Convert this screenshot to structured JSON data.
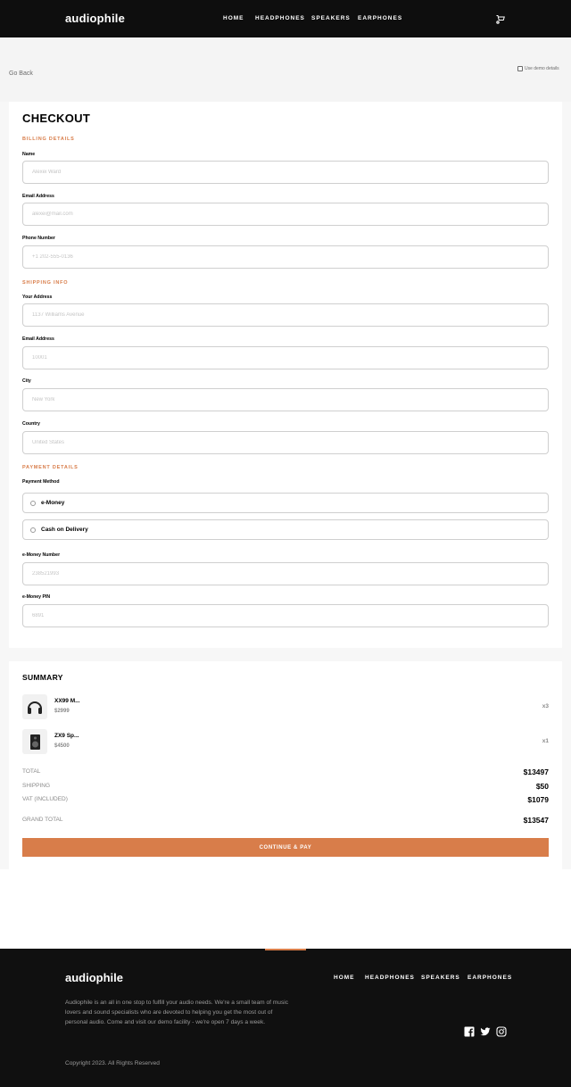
{
  "header": {
    "logo": "audiophile",
    "nav": [
      "HOME",
      "HEADPHONES",
      "SPEAKERS",
      "EARPHONES"
    ],
    "cart_icon": "cart-icon"
  },
  "subbar": {
    "go_back": "Go Back",
    "demo_label": "Use demo details"
  },
  "checkout": {
    "title": "CHECKOUT",
    "billing": {
      "heading": "BILLING DETAILS",
      "name_label": "Name",
      "name_placeholder": "Alexei Ward",
      "email_label": "Email Address",
      "email_placeholder": "alexei@mail.com",
      "phone_label": "Phone Number",
      "phone_placeholder": "+1 202-555-0136"
    },
    "shipping": {
      "heading": "SHIPPING INFO",
      "address_label": "Your Address",
      "address_placeholder": "1137 Williams Avenue",
      "zip_label": "Email Address",
      "zip_placeholder": "10001",
      "city_label": "City",
      "city_placeholder": "New York",
      "country_label": "Country",
      "country_placeholder": "United States"
    },
    "payment": {
      "heading": "PAYMENT DETAILS",
      "method_label": "Payment Method",
      "options": [
        "e-Money",
        "Cash on Delivery"
      ],
      "emoney_number_label": "e-Money Number",
      "emoney_number_placeholder": "238521993",
      "emoney_pin_label": "e-Money PIN",
      "emoney_pin_placeholder": "6891"
    }
  },
  "summary": {
    "title": "SUMMARY",
    "items": [
      {
        "name": "XX99 M...",
        "price": "$2999",
        "qty": "x3",
        "icon": "headphones-icon"
      },
      {
        "name": "ZX9 Sp...",
        "price": "$4500",
        "qty": "x1",
        "icon": "speaker-icon"
      }
    ],
    "totals": {
      "total_label": "TOTAL",
      "total_value": "$13497",
      "shipping_label": "SHIPPING",
      "shipping_value": "$50",
      "vat_label": "VAT (INCLUDED)",
      "vat_value": "$1079",
      "grand_label": "GRAND TOTAL",
      "grand_value": "$13547"
    },
    "pay_button": "CONTINUE & PAY"
  },
  "footer": {
    "logo": "audiophile",
    "nav": [
      "HOME",
      "HEADPHONES",
      "SPEAKERS",
      "EARPHONES"
    ],
    "about": "Audiophile is an all in one stop to fulfill your audio needs. We're a small team of music lovers and sound specialists who are devoted to helping you get the most out of personal audio. Come and visit our demo facility - we're open 7 days a week.",
    "copyright": "Copyright 2023. All Rights Reserved",
    "social_icons": [
      "facebook-icon",
      "twitter-icon",
      "instagram-icon"
    ]
  },
  "colors": {
    "accent": "#d87d4a",
    "dark": "#101010",
    "light_bg": "#f7f7f7"
  }
}
